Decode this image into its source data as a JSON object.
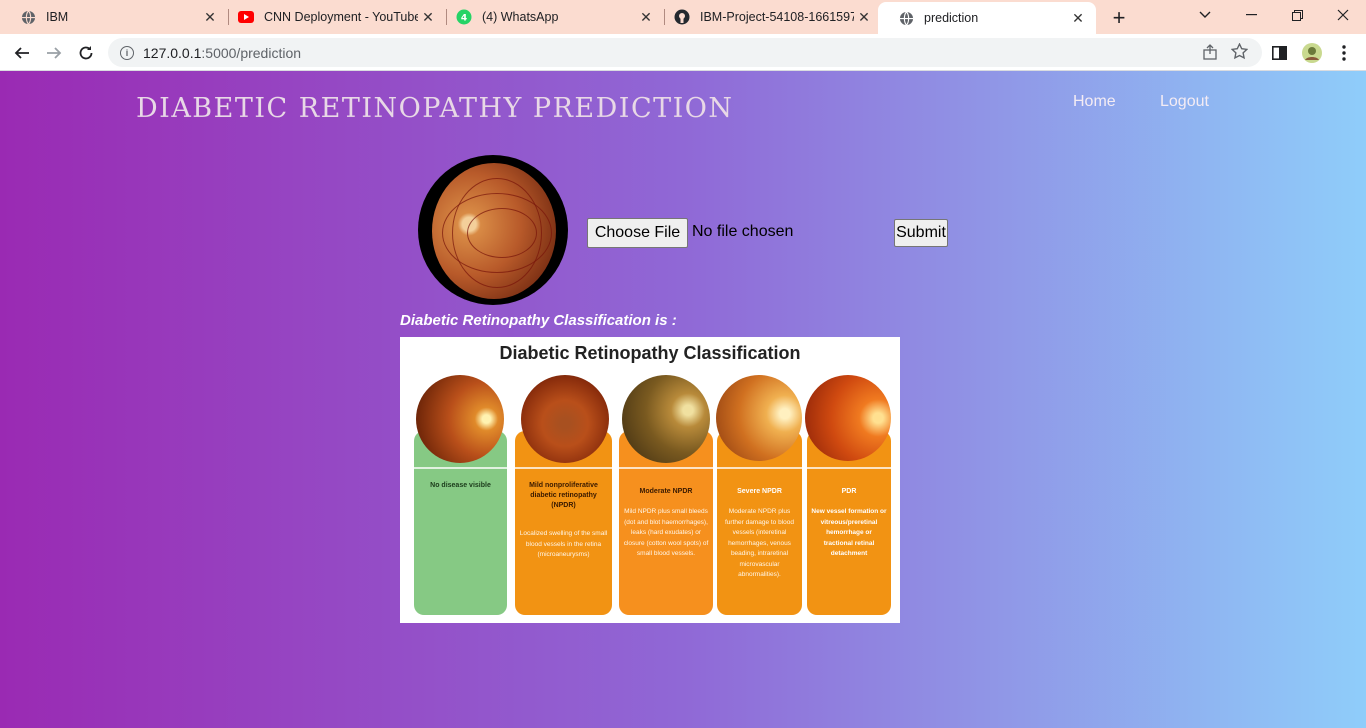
{
  "browser": {
    "tabs": [
      {
        "title": "IBM",
        "icon": "globe-icon"
      },
      {
        "title": "CNN Deployment - YouTube",
        "icon": "youtube-icon"
      },
      {
        "title": "(4) WhatsApp",
        "icon": "whatsapp-icon"
      },
      {
        "title": "IBM-Project-54108-1661597...",
        "icon": "github-icon"
      },
      {
        "title": "prediction",
        "icon": "globe-icon"
      }
    ],
    "url_host": "127.0.0.1",
    "url_path": ":5000/prediction"
  },
  "page": {
    "site_title": "DIABETIC RETINOPATHY PREDICTION",
    "nav": {
      "home": "Home",
      "logout": "Logout"
    },
    "upload": {
      "choose_label": "Choose File",
      "file_status": "No file chosen",
      "submit_label": "Submit"
    },
    "result_label": "Diabetic Retinopathy Classification is :",
    "infographic": {
      "title": "Diabetic Retinopathy Classification",
      "cards": [
        {
          "name": "No disease visible",
          "desc": "",
          "color": "#86c984"
        },
        {
          "name": "Mild nonproliferative diabetic retinopathy (NPDR)",
          "desc": "Localized swelling of the small blood vessels in the retina (microaneurysms)",
          "color": "#f29313"
        },
        {
          "name": "Moderate NPDR",
          "desc": "Mild NPDR plus small bleeds (dot and blot haemorrhages), leaks (hard exudates) or closure (cotton wool spots) of small blood vessels.",
          "color": "#f6901e"
        },
        {
          "name": "Severe NPDR",
          "desc": "Moderate NPDR plus further damage to blood vessels (interetinal hemorrhages, venous beading, intraretinal microvascular abnormalities).",
          "color": "#f29313"
        },
        {
          "name": "PDR",
          "desc": "New vessel formation or vitreous/preretinal hemorrhage or tractional retinal detachment",
          "color": "#f29313"
        }
      ]
    }
  }
}
